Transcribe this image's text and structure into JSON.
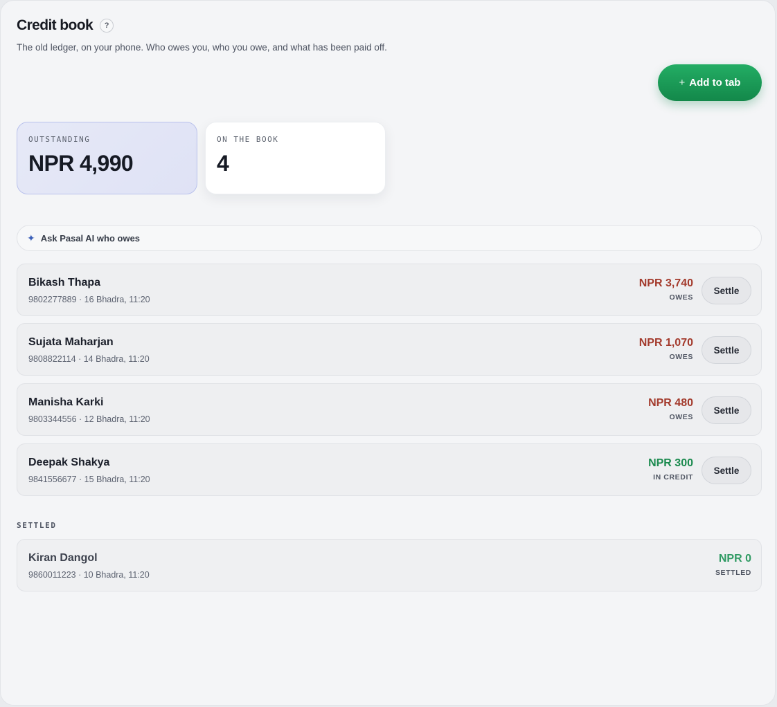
{
  "header": {
    "title": "Credit book",
    "help": "?",
    "subtitle": "The old ledger, on your phone. Who owes you, who you owe, and what has been paid off."
  },
  "add_button": {
    "icon": "+",
    "label": "Add to tab"
  },
  "stats": {
    "outstanding": {
      "label": "OUTSTANDING",
      "value": "NPR 4,990"
    },
    "on_book": {
      "label": "ON THE BOOK",
      "value": "4"
    }
  },
  "ask_ai": {
    "icon": "sparkle-icon",
    "label": "Ask Pasal AI who owes"
  },
  "entries": [
    {
      "name": "Bikash Thapa",
      "meta": "9802277889 · 16 Bhadra, 11:20",
      "amount": "NPR 3,740",
      "status": "OWES",
      "action": "Settle"
    },
    {
      "name": "Sujata Maharjan",
      "meta": "9808822114 · 14 Bhadra, 11:20",
      "amount": "NPR 1,070",
      "status": "OWES",
      "action": "Settle"
    },
    {
      "name": "Manisha Karki",
      "meta": "9803344556 · 12 Bhadra, 11:20",
      "amount": "NPR 480",
      "status": "OWES",
      "action": "Settle"
    },
    {
      "name": "Deepak Shakya",
      "meta": "9841556677 · 15 Bhadra, 11:20",
      "amount": "NPR 300",
      "status": "IN CREDIT",
      "action": "Settle"
    }
  ],
  "settled": {
    "heading": "SETTLED",
    "entries": [
      {
        "name": "Kiran Dangol",
        "meta": "9860011223 · 10 Bhadra, 11:20",
        "amount": "NPR 0",
        "status": "SETTLED"
      }
    ]
  },
  "colors": {
    "owes": "#a33a2c",
    "credit": "#1a8a4e",
    "accent": "#1a9a58"
  }
}
